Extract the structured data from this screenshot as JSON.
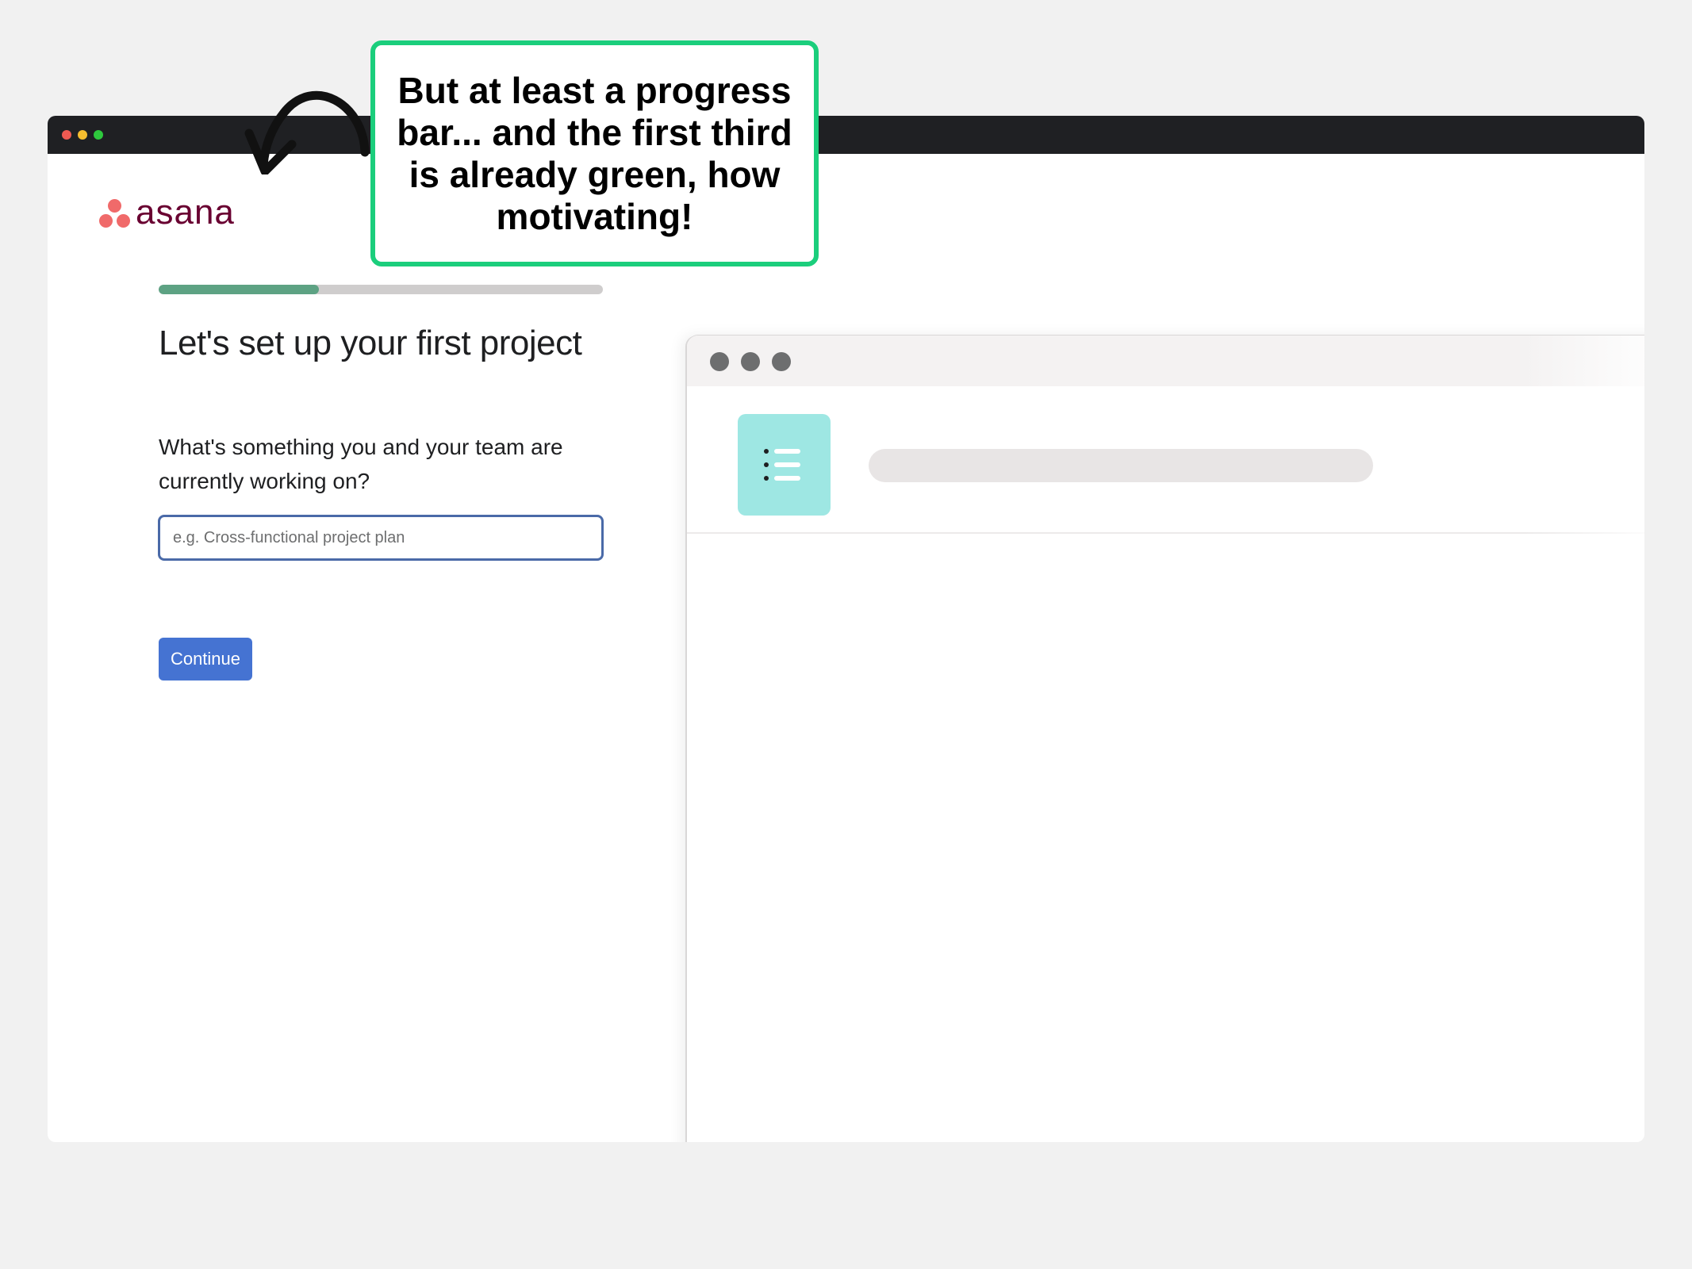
{
  "annotation": {
    "text": "But at least a progress bar... and the first third is already green, how motivating!",
    "border_color": "#1bce7c"
  },
  "window": {
    "traffic_lights": [
      "close",
      "minimize",
      "zoom"
    ]
  },
  "brand": {
    "logo_text": "asana",
    "logo_color": "#690031",
    "mark_color": "#f06a6a"
  },
  "onboarding": {
    "progress_fraction": 0.36,
    "progress_color": "#5da283",
    "heading": "Let's set up your first project",
    "question": "What's something you and your team are currently working on?",
    "project_input": {
      "value": "",
      "placeholder": "e.g. Cross-functional project plan"
    },
    "continue_label": "Continue",
    "accent_color": "#4573d2"
  },
  "preview": {
    "icon": "list-icon",
    "icon_bg": "#9ee7e3"
  }
}
